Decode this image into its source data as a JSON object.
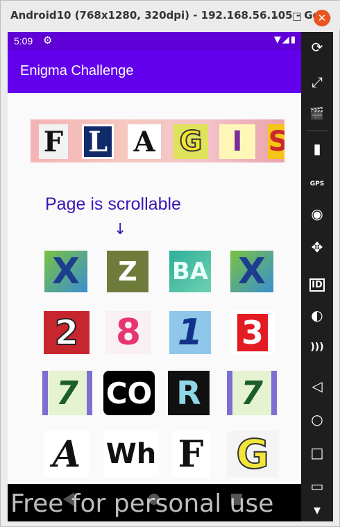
{
  "window": {
    "title": "Android10 (768x1280, 320dpi) - 192.168.56.105 - Ge...",
    "minimize": "–",
    "maximize": "□",
    "close": "✕"
  },
  "statusbar": {
    "time": "5:09",
    "gear": "⚙",
    "icons": "▼◢▮"
  },
  "appbar": {
    "title": "Enigma Challenge"
  },
  "banner": {
    "tiles": [
      "F",
      "L",
      "A",
      "G",
      "I",
      "S"
    ]
  },
  "hint": {
    "text": "Page is scrollable",
    "arrow": "↓"
  },
  "grid": {
    "rows": [
      [
        "X",
        "Z",
        "BA",
        "X"
      ],
      [
        "2",
        "8",
        "1",
        "3"
      ],
      [
        "7",
        "CO",
        "R",
        "7"
      ],
      [
        "A",
        "Wh",
        "F",
        "G"
      ]
    ]
  },
  "navbar": {
    "watermark": "Free for personal use"
  },
  "sidebar": {
    "items": [
      "⟳",
      "⤢",
      "🎬",
      "▮",
      "GPS",
      "◉",
      "✥",
      "ID",
      "◐",
      ")))",
      "◁",
      "○",
      "□",
      "▭",
      "▾"
    ]
  },
  "colors": {
    "statusbar": "#5e00d6",
    "appbar": "#6200ee",
    "hint": "#3d16b8"
  }
}
